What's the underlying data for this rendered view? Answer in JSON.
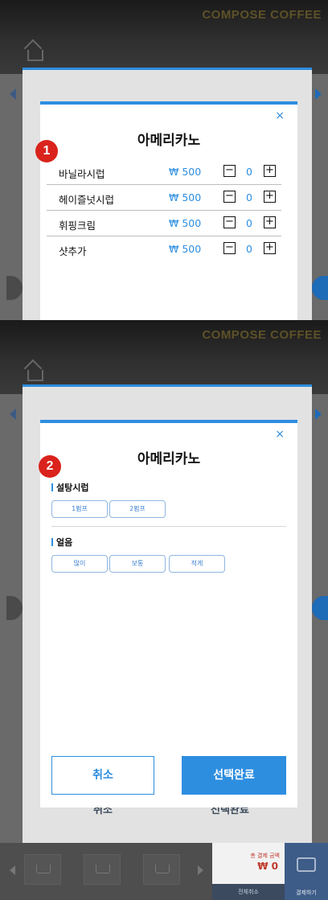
{
  "brand": "COMPOSE COFFEE",
  "panel1": {
    "badge": "1",
    "modal_title": "아메리카노",
    "close_symbol": "×",
    "currency": "₩",
    "items": [
      {
        "label": "바닐라시럽",
        "price": "₩ 500",
        "qty": "0"
      },
      {
        "label": "헤이즐넛시럽",
        "price": "₩ 500",
        "qty": "0"
      },
      {
        "label": "휘핑크림",
        "price": "₩ 500",
        "qty": "0"
      },
      {
        "label": "샷추가",
        "price": "₩ 500",
        "qty": "0"
      }
    ],
    "minus_symbol": "−",
    "plus_symbol": "+"
  },
  "panel2": {
    "badge": "2",
    "modal_title": "아메리카노",
    "close_symbol": "×",
    "sections": [
      {
        "title": "설탕시럽",
        "options": [
          "1펌프",
          "2펌프"
        ]
      },
      {
        "title": "얼음",
        "options": [
          "많이",
          "보통",
          "적게"
        ]
      }
    ],
    "cancel_label": "취소",
    "done_label": "선택완료",
    "behind_cancel_label": "취소",
    "behind_done_label": "선택완료"
  },
  "footer": {
    "total_label": "총 결제 금액",
    "total_value": "₩ 0",
    "cancel_all_label": "전체취소",
    "pay_label": "결제하기"
  },
  "colors": {
    "accent": "#2d8ee0",
    "badge": "#d9231c",
    "brand_gold": "#5d5128"
  }
}
